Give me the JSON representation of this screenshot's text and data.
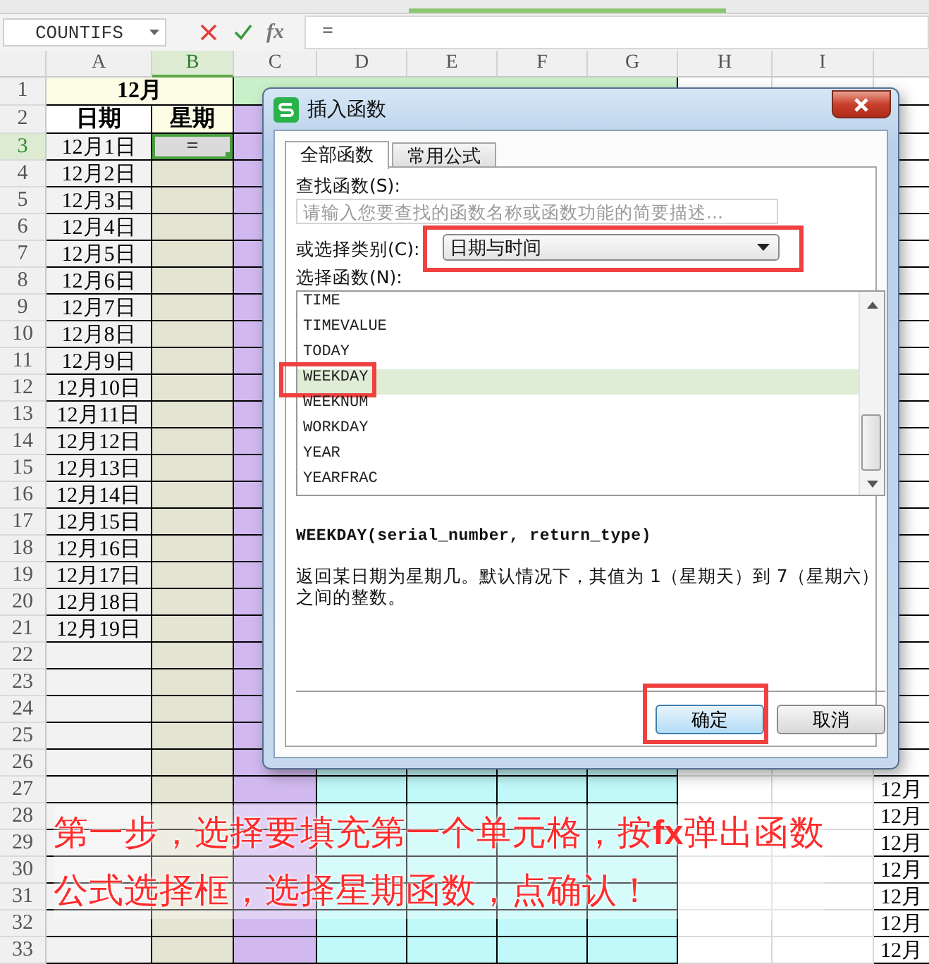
{
  "formula_bar": {
    "name_box": "COUNTIFS",
    "function_icon": "fx",
    "formula": "="
  },
  "sheet": {
    "columns": [
      {
        "label": "A",
        "selected": false
      },
      {
        "label": "B",
        "selected": true
      },
      {
        "label": "C",
        "selected": false
      },
      {
        "label": "D",
        "selected": false
      },
      {
        "label": "E",
        "selected": false
      },
      {
        "label": "F",
        "selected": false
      },
      {
        "label": "G",
        "selected": false
      },
      {
        "label": "H",
        "selected": false
      },
      {
        "label": "I",
        "selected": false
      }
    ],
    "rows": [
      {
        "label": "1",
        "kind": "title",
        "selected": false,
        "cells": {
          "A": {
            "text": "12月",
            "selected": false
          }
        }
      },
      {
        "label": "2",
        "kind": "header",
        "selected": false,
        "cells": {
          "A": {
            "text": "日期",
            "selected": false
          },
          "B": {
            "text": "星期",
            "selected": false
          }
        }
      },
      {
        "label": "3",
        "kind": "data",
        "selected": true,
        "cells": {
          "A": {
            "text": "12月1日",
            "selected": false
          },
          "B": {
            "text": "=",
            "selected": true
          }
        }
      },
      {
        "label": "4",
        "kind": "data",
        "selected": false,
        "cells": {
          "A": {
            "text": "12月2日",
            "selected": false
          }
        }
      },
      {
        "label": "5",
        "kind": "data",
        "selected": false,
        "cells": {
          "A": {
            "text": "12月3日",
            "selected": false
          }
        }
      },
      {
        "label": "6",
        "kind": "data",
        "selected": false,
        "cells": {
          "A": {
            "text": "12月4日",
            "selected": false
          }
        }
      },
      {
        "label": "7",
        "kind": "data",
        "selected": false,
        "cells": {
          "A": {
            "text": "12月5日",
            "selected": false
          }
        }
      },
      {
        "label": "8",
        "kind": "data",
        "selected": false,
        "cells": {
          "A": {
            "text": "12月6日",
            "selected": false
          }
        }
      },
      {
        "label": "9",
        "kind": "data",
        "selected": false,
        "cells": {
          "A": {
            "text": "12月7日",
            "selected": false
          }
        }
      },
      {
        "label": "10",
        "kind": "data",
        "selected": false,
        "cells": {
          "A": {
            "text": "12月8日",
            "selected": false
          }
        }
      },
      {
        "label": "11",
        "kind": "data",
        "selected": false,
        "cells": {
          "A": {
            "text": "12月9日",
            "selected": false
          }
        }
      },
      {
        "label": "12",
        "kind": "data",
        "selected": false,
        "cells": {
          "A": {
            "text": "12月10日",
            "selected": false
          }
        }
      },
      {
        "label": "13",
        "kind": "data",
        "selected": false,
        "cells": {
          "A": {
            "text": "12月11日",
            "selected": false
          }
        }
      },
      {
        "label": "14",
        "kind": "data",
        "selected": false,
        "cells": {
          "A": {
            "text": "12月12日",
            "selected": false
          }
        }
      },
      {
        "label": "15",
        "kind": "data",
        "selected": false,
        "cells": {
          "A": {
            "text": "12月13日",
            "selected": false
          }
        }
      },
      {
        "label": "16",
        "kind": "data",
        "selected": false,
        "cells": {
          "A": {
            "text": "12月14日",
            "selected": false
          }
        }
      },
      {
        "label": "17",
        "kind": "data",
        "selected": false,
        "cells": {
          "A": {
            "text": "12月15日",
            "selected": false
          }
        }
      },
      {
        "label": "18",
        "kind": "data",
        "selected": false,
        "cells": {
          "A": {
            "text": "12月16日",
            "selected": false
          }
        }
      },
      {
        "label": "19",
        "kind": "data",
        "selected": false,
        "cells": {
          "A": {
            "text": "12月17日",
            "selected": false
          }
        }
      },
      {
        "label": "20",
        "kind": "data",
        "selected": false,
        "cells": {
          "A": {
            "text": "12月18日",
            "selected": false
          }
        }
      },
      {
        "label": "21",
        "kind": "data",
        "selected": false,
        "cells": {
          "A": {
            "text": "12月19日",
            "selected": false
          }
        }
      },
      {
        "label": "22",
        "kind": "data",
        "selected": false
      },
      {
        "label": "23",
        "kind": "data",
        "selected": false
      },
      {
        "label": "24",
        "kind": "data",
        "selected": false
      },
      {
        "label": "25",
        "kind": "data",
        "selected": false
      },
      {
        "label": "26",
        "kind": "data",
        "selected": false
      },
      {
        "label": "27",
        "kind": "data",
        "selected": false,
        "cells": {
          "J": {
            "text": "12月",
            "selected": false
          }
        }
      },
      {
        "label": "28",
        "kind": "data",
        "selected": false,
        "cells": {
          "J": {
            "text": "12月",
            "selected": false
          }
        }
      },
      {
        "label": "29",
        "kind": "data",
        "selected": false,
        "cells": {
          "J": {
            "text": "12月",
            "selected": false
          }
        }
      },
      {
        "label": "30",
        "kind": "data",
        "selected": false,
        "cells": {
          "J": {
            "text": "12月",
            "selected": false
          }
        }
      },
      {
        "label": "31",
        "kind": "data",
        "selected": false,
        "cells": {
          "J": {
            "text": "12月",
            "selected": false
          }
        }
      },
      {
        "label": "32",
        "kind": "data",
        "selected": false,
        "cells": {
          "J": {
            "text": "12月",
            "selected": false
          }
        }
      },
      {
        "label": "33",
        "kind": "data",
        "selected": false,
        "cells": {
          "J": {
            "text": "12月",
            "selected": false
          }
        }
      }
    ]
  },
  "dialog": {
    "title": "插入函数",
    "tabs": [
      {
        "label": "全部函数",
        "selected": true
      },
      {
        "label": "常用公式",
        "selected": false
      }
    ],
    "search_label": "查找函数(S):",
    "search": {
      "placeholder": "请输入您要查找的函数名称或函数功能的简要描述..."
    },
    "category_label": "或选择类别(C):",
    "category": {
      "value": "日期与时间",
      "highlighted": true
    },
    "function_label": "选择函数(N):",
    "functions": [
      {
        "name": "TIME",
        "selected": false,
        "highlighted": false
      },
      {
        "name": "TIMEVALUE",
        "selected": false,
        "highlighted": false
      },
      {
        "name": "TODAY",
        "selected": false,
        "highlighted": false
      },
      {
        "name": "WEEKDAY",
        "selected": true,
        "highlighted": true
      },
      {
        "name": "WEEKNUM",
        "selected": false,
        "highlighted": false
      },
      {
        "name": "WORKDAY",
        "selected": false,
        "highlighted": false
      },
      {
        "name": "YEAR",
        "selected": false,
        "highlighted": false
      },
      {
        "name": "YEARFRAC",
        "selected": false,
        "highlighted": false
      }
    ],
    "signature": "WEEKDAY(serial_number, return_type)",
    "description": "返回某日期为星期几。默认情况下，其值为 1（星期天）到 7（星期六）之间的整数。",
    "buttons": [
      {
        "label": "确定",
        "kind": "primary",
        "highlighted": true
      },
      {
        "label": "取消",
        "kind": "secondary",
        "highlighted": false
      }
    ]
  },
  "annotation": {
    "lines": [
      "第一步，选择要填充第一个单元格，按**fx**弹出函数",
      "公式选择框，选择星期函数，点确认！"
    ]
  }
}
